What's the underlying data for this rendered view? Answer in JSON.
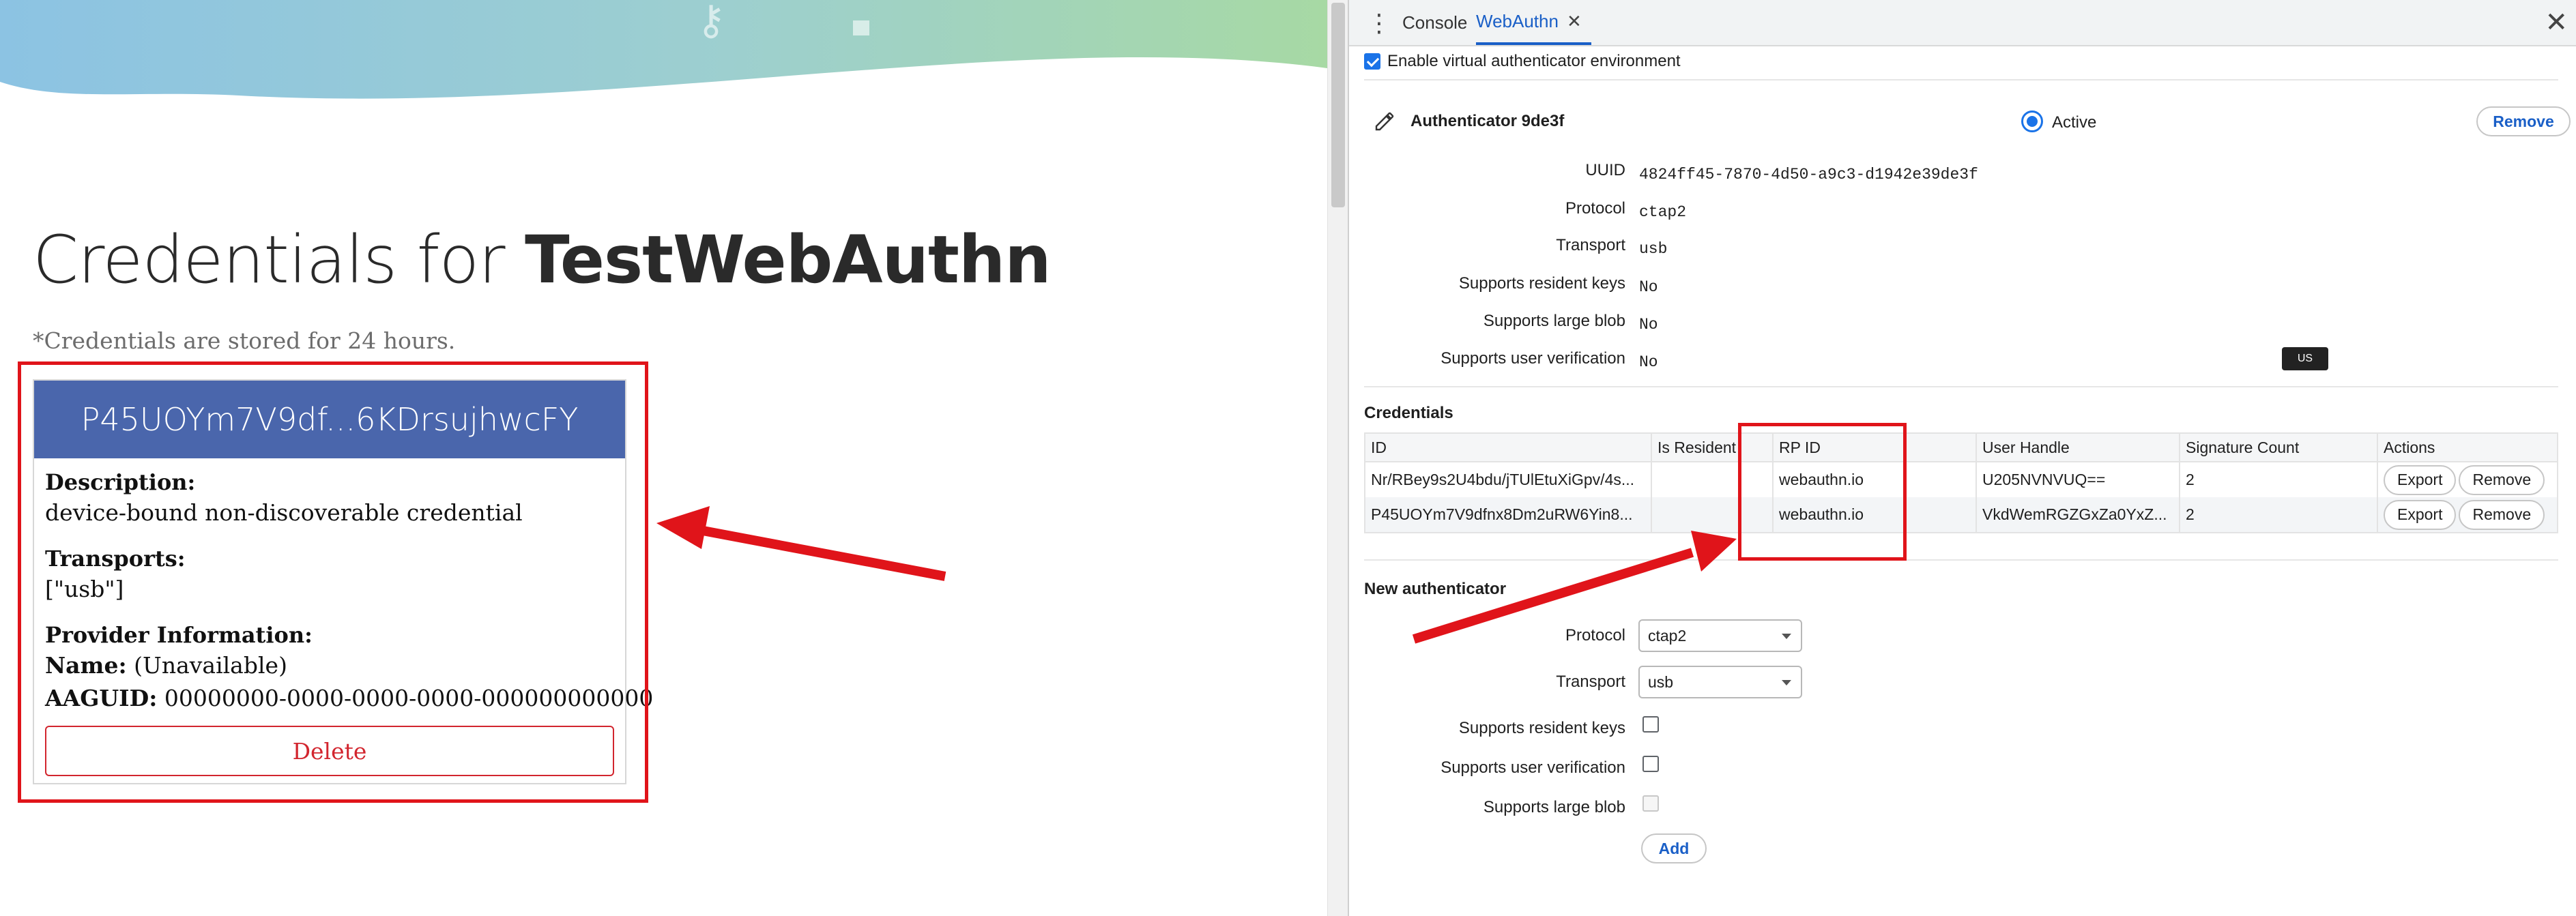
{
  "left_page": {
    "title_prefix": "Credentials for ",
    "title_site": "TestWebAuthn",
    "storage_note": "*Credentials are stored for 24 hours.",
    "card": {
      "header": "P45UOYm7V9df...6KDrsujhwcFY",
      "description_label": "Description:",
      "description_value": "device-bound non-discoverable credential",
      "transports_label": "Transports:",
      "transports_value": "[\"usb\"]",
      "provider_label": "Provider Information:",
      "name_label": "Name:",
      "name_value": " (Unavailable)",
      "aaguid_label": "AAGUID:",
      "aaguid_value": " 00000000-0000-0000-0000-000000000000",
      "delete_label": "Delete"
    }
  },
  "devtools": {
    "tabs": [
      {
        "label": "Console"
      },
      {
        "label": "WebAuthn"
      }
    ],
    "enable_env_label": "Enable virtual authenticator environment",
    "authenticator": {
      "name": "Authenticator 9de3f",
      "active_label": "Active",
      "remove_label": "Remove",
      "props": [
        {
          "label": "UUID",
          "value": "4824ff45-7870-4d50-a9c3-d1942e39de3f"
        },
        {
          "label": "Protocol",
          "value": "ctap2"
        },
        {
          "label": "Transport",
          "value": "usb"
        },
        {
          "label": "Supports resident keys",
          "value": "No"
        },
        {
          "label": "Supports large blob",
          "value": "No"
        },
        {
          "label": "Supports user verification",
          "value": "No"
        }
      ]
    },
    "credentials": {
      "heading": "Credentials",
      "columns": [
        "ID",
        "Is Resident",
        "RP ID",
        "User Handle",
        "Signature Count",
        "Actions"
      ],
      "rows": [
        {
          "id": "Nr/RBey9s2U4bdu/jTUlEtuXiGpv/4s...",
          "is_resident": "",
          "rp_id": "webauthn.io",
          "user_handle": "U205NVNVUQ==",
          "signature_count": "2"
        },
        {
          "id": "P45UOYm7V9dfnx8Dm2uRW6Yin8...",
          "is_resident": "",
          "rp_id": "webauthn.io",
          "user_handle": "VkdWemRGZGxZa0YxZ...",
          "signature_count": "2"
        }
      ],
      "export_label": "Export",
      "remove_label": "Remove"
    },
    "new_authenticator": {
      "heading": "New authenticator",
      "protocol_label": "Protocol",
      "protocol_value": "ctap2",
      "transport_label": "Transport",
      "transport_value": "usb",
      "resident_keys_label": "Supports resident keys",
      "user_verification_label": "Supports user verification",
      "large_blob_label": "Supports large blob",
      "add_label": "Add"
    },
    "lang_badge": "US"
  },
  "colors": {
    "card_header": "#4a66ac",
    "delete": "#d2252e",
    "highlight": "#e0141a",
    "devtools_accent": "#1a73e8"
  }
}
